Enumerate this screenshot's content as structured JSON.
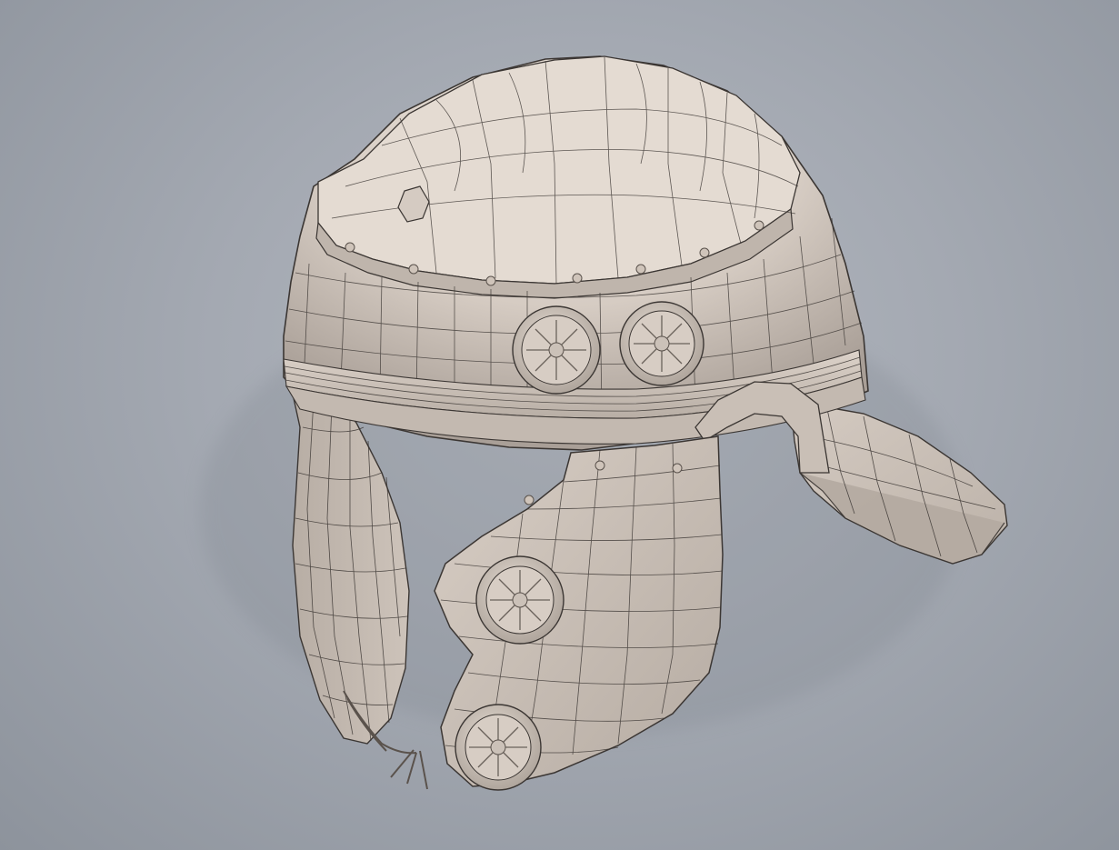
{
  "viewport": {
    "background_center": "#b3b8c0",
    "background_edge": "#8d939c"
  },
  "helmet": {
    "subject": "roman-helmet-wireframe-model",
    "surface_color": "#d9cfc6",
    "surface_shadow": "#9c928a",
    "wire_color": "#3b3633",
    "rosette_count": 4,
    "rivet_color": "#cfc4ba"
  }
}
